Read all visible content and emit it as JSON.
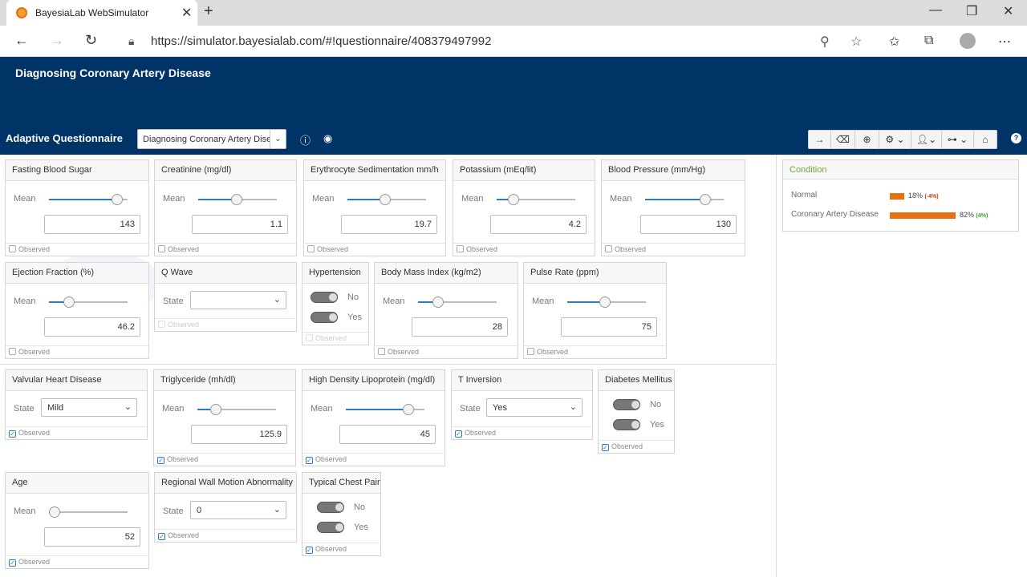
{
  "browser": {
    "tab_title": "BayesiaLab WebSimulator",
    "url": "https://simulator.bayesialab.com/#!questionnaire/408379497992"
  },
  "app": {
    "title": "Diagnosing Coronary Artery Disease",
    "questionnaire_label": "Adaptive Questionnaire",
    "questionnaire_select": "Diagnosing Coronary Artery Disease"
  },
  "labels": {
    "mean": "Mean",
    "state": "State",
    "observed": "Observed",
    "no": "No",
    "yes": "Yes"
  },
  "cards": {
    "fbs": {
      "title": "Fasting Blood Sugar",
      "value": "143",
      "level": 0.87,
      "observed": false
    },
    "creat": {
      "title": "Creatinine (mg/dl)",
      "value": "1.1",
      "level": 0.49,
      "observed": false
    },
    "esr": {
      "title": "Erythrocyte Sedimentation mm/h",
      "value": "19.7",
      "level": 0.48,
      "observed": false
    },
    "potassium": {
      "title": "Potassium (mEq/lit)",
      "value": "4.2",
      "level": 0.21,
      "observed": false
    },
    "bp": {
      "title": "Blood Pressure (mm/Hg)",
      "value": "130",
      "level": 0.77,
      "observed": false
    },
    "ef": {
      "title": "Ejection Fraction (%)",
      "value": "46.2",
      "level": 0.26,
      "observed": false
    },
    "qwave": {
      "title": "Q Wave",
      "state": "",
      "observed": false
    },
    "htn": {
      "title": "Hypertension",
      "observed": false
    },
    "bmi": {
      "title": "Body Mass Index (kg/m2)",
      "value": "28",
      "level": 0.25,
      "observed": false
    },
    "pulse": {
      "title": "Pulse Rate (ppm)",
      "value": "75",
      "level": 0.48,
      "observed": false
    },
    "vhd": {
      "title": "Valvular Heart Disease",
      "state": "Mild",
      "observed": true
    },
    "tg": {
      "title": "Triglyceride (mh/dl)",
      "value": "125.9",
      "level": 0.23,
      "observed": true
    },
    "hdl": {
      "title": "High Density Lipoprotein (mg/dl)",
      "value": "45",
      "level": 0.8,
      "observed": true
    },
    "tinv": {
      "title": "T Inversion",
      "state": "Yes",
      "observed": true
    },
    "dm": {
      "title": "Diabetes Mellitus",
      "observed": true
    },
    "age": {
      "title": "Age",
      "value": "52",
      "level": 0.07,
      "observed": true
    },
    "rwma": {
      "title": "Regional Wall Motion Abnormality",
      "state": "0",
      "observed": true
    },
    "tcp": {
      "title": "Typical Chest Pain",
      "observed": true
    }
  },
  "condition": {
    "title": "Condition",
    "rows": [
      {
        "label": "Normal",
        "value": "18%",
        "delta": "(-4%)",
        "fraction": 0.18,
        "delta_color": "#cc3300"
      },
      {
        "label": "Coronary Artery Disease",
        "value": "82%",
        "delta": "(4%)",
        "fraction": 0.82,
        "delta_color": "#3a9a2a"
      }
    ]
  },
  "colors": {
    "header": "#003466",
    "accent": "#2a7ac8",
    "bar": "#e8700e",
    "condition_title": "#6aaa3a"
  }
}
